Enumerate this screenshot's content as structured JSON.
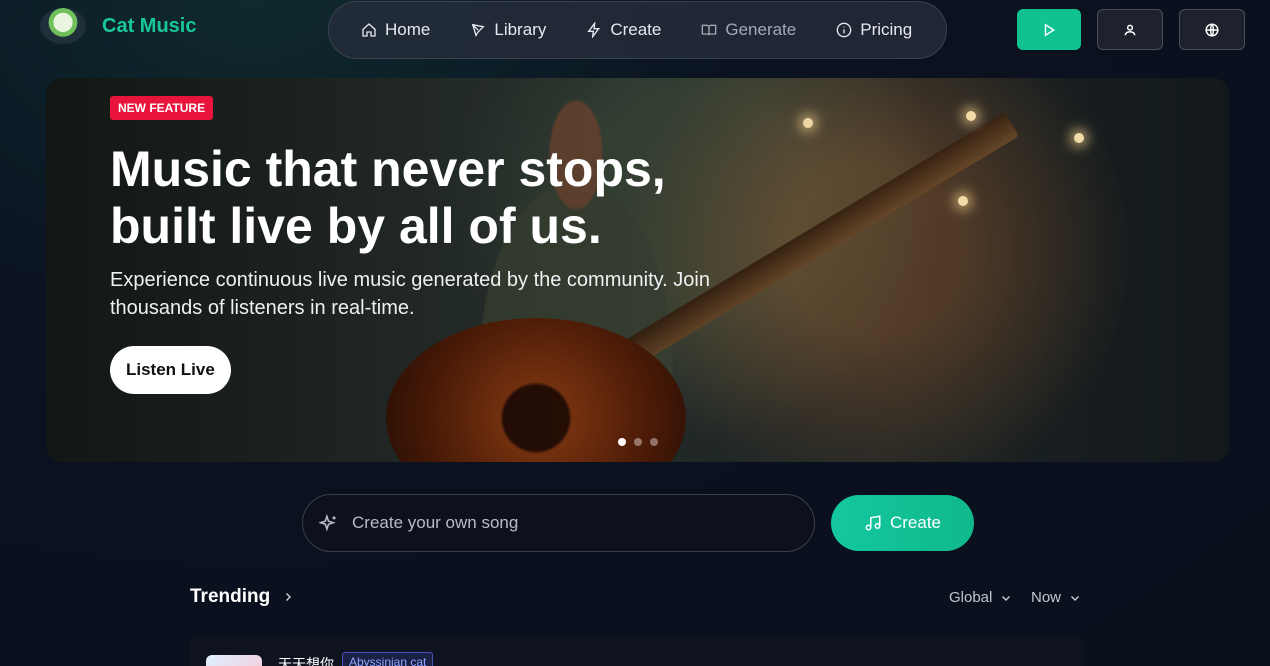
{
  "header": {
    "app_name": "Cat Music",
    "nav": [
      {
        "label": "Home",
        "icon": "home-icon",
        "dim": false
      },
      {
        "label": "Library",
        "icon": "library-icon",
        "dim": false
      },
      {
        "label": "Create",
        "icon": "lightning-icon",
        "dim": false
      },
      {
        "label": "Generate",
        "icon": "book-icon",
        "dim": true
      },
      {
        "label": "Pricing",
        "icon": "info-icon",
        "dim": false
      }
    ],
    "buttons": {
      "play": "play-icon",
      "account": "user-icon",
      "language": "globe-icon"
    },
    "accent_color": "#10c28f"
  },
  "hero": {
    "badge": "NEW FEATURE",
    "title_line1": "Music that never stops,",
    "title_line2": "built live by all of us.",
    "subtitle_line1": "Experience continuous live music generated by the community. Join",
    "subtitle_line2": "thousands of listeners in real-time.",
    "cta": "Listen Live",
    "slides": 3,
    "active_slide": 1,
    "badge_color": "#e8143c"
  },
  "create": {
    "placeholder": "Create your own song",
    "button": "Create"
  },
  "trending": {
    "title": "Trending",
    "region": "Global",
    "period": "Now",
    "items": [
      {
        "title": "天天想你",
        "tag": "Abyssinian cat"
      }
    ]
  }
}
